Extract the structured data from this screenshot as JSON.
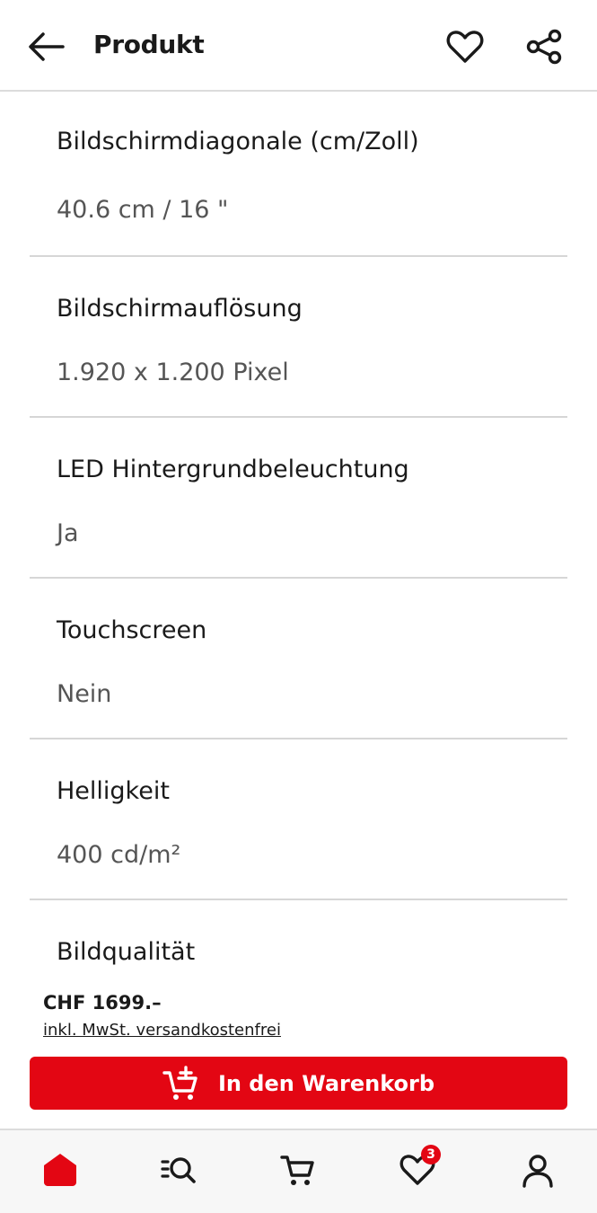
{
  "header": {
    "title": "Produkt"
  },
  "specs": [
    {
      "label": "Bildschirmdiagonale (cm/Zoll)",
      "value": "40.6 cm / 16 \""
    },
    {
      "label": "Bildschirmauflösung",
      "value": "1.920 x 1.200 Pixel"
    },
    {
      "label": "LED Hintergrundbeleuchtung",
      "value": "Ja"
    },
    {
      "label": "Touchscreen",
      "value": "Nein"
    },
    {
      "label": "Helligkeit",
      "value": "400 cd/m²"
    },
    {
      "label": "Bildqualität",
      "value": ""
    }
  ],
  "buy": {
    "price": "CHF 1699.–",
    "note": "inkl. MwSt. versandkostenfrei",
    "cart_label": "In den Warenkorb"
  },
  "nav": {
    "wishlist_badge": "3"
  },
  "colors": {
    "accent": "#e30613"
  }
}
